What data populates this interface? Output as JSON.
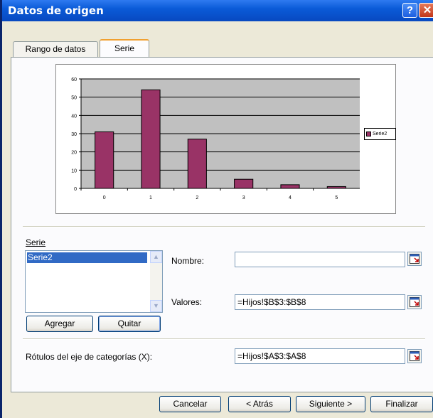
{
  "window": {
    "title": "Datos de origen",
    "help_label": "?",
    "close_label": "✕"
  },
  "tabs": [
    {
      "label": "Rango de datos",
      "active": false
    },
    {
      "label": "Serie",
      "active": true
    }
  ],
  "chart_data": {
    "type": "bar",
    "categories": [
      "0",
      "1",
      "2",
      "3",
      "4",
      "5"
    ],
    "series": [
      {
        "name": "Serie2",
        "values": [
          31,
          54,
          27,
          5,
          2,
          1
        ],
        "color": "#993366"
      }
    ],
    "ylim": [
      0,
      60
    ],
    "yticks": [
      "0",
      "10",
      "20",
      "30",
      "40",
      "50",
      "60"
    ],
    "grid": true,
    "plot_background": "#C0C0C0",
    "legend_position": "right"
  },
  "series_panel": {
    "label": "Serie",
    "items": [
      "Serie2"
    ],
    "add_label": "Agregar",
    "remove_label": "Quitar"
  },
  "fields": {
    "name_label": "Nombre:",
    "name_value": "",
    "values_label": "Valores:",
    "values_value": "=Hijos!$B$3:$B$8",
    "category_label": "Rótulos del eje de categorías (X):",
    "category_value": "=Hijos!$A$3:$A$8"
  },
  "footer": {
    "cancel_label": "Cancelar",
    "back_label": "< Atrás",
    "next_label": "Siguiente >",
    "finish_label": "Finalizar"
  }
}
